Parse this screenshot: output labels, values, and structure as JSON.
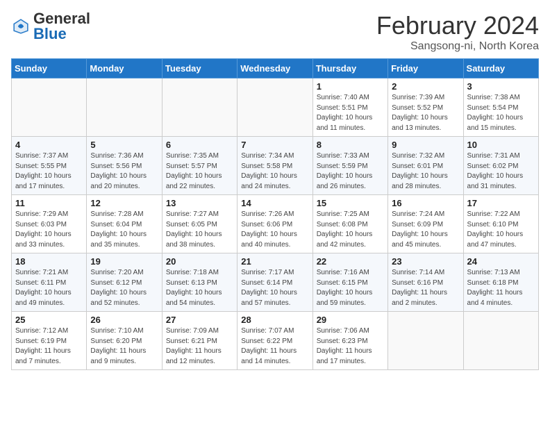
{
  "header": {
    "logo_general": "General",
    "logo_blue": "Blue",
    "month_title": "February 2024",
    "location": "Sangsong-ni, North Korea"
  },
  "days_of_week": [
    "Sunday",
    "Monday",
    "Tuesday",
    "Wednesday",
    "Thursday",
    "Friday",
    "Saturday"
  ],
  "weeks": [
    [
      {
        "day": "",
        "info": ""
      },
      {
        "day": "",
        "info": ""
      },
      {
        "day": "",
        "info": ""
      },
      {
        "day": "",
        "info": ""
      },
      {
        "day": "1",
        "info": "Sunrise: 7:40 AM\nSunset: 5:51 PM\nDaylight: 10 hours\nand 11 minutes."
      },
      {
        "day": "2",
        "info": "Sunrise: 7:39 AM\nSunset: 5:52 PM\nDaylight: 10 hours\nand 13 minutes."
      },
      {
        "day": "3",
        "info": "Sunrise: 7:38 AM\nSunset: 5:54 PM\nDaylight: 10 hours\nand 15 minutes."
      }
    ],
    [
      {
        "day": "4",
        "info": "Sunrise: 7:37 AM\nSunset: 5:55 PM\nDaylight: 10 hours\nand 17 minutes."
      },
      {
        "day": "5",
        "info": "Sunrise: 7:36 AM\nSunset: 5:56 PM\nDaylight: 10 hours\nand 20 minutes."
      },
      {
        "day": "6",
        "info": "Sunrise: 7:35 AM\nSunset: 5:57 PM\nDaylight: 10 hours\nand 22 minutes."
      },
      {
        "day": "7",
        "info": "Sunrise: 7:34 AM\nSunset: 5:58 PM\nDaylight: 10 hours\nand 24 minutes."
      },
      {
        "day": "8",
        "info": "Sunrise: 7:33 AM\nSunset: 5:59 PM\nDaylight: 10 hours\nand 26 minutes."
      },
      {
        "day": "9",
        "info": "Sunrise: 7:32 AM\nSunset: 6:01 PM\nDaylight: 10 hours\nand 28 minutes."
      },
      {
        "day": "10",
        "info": "Sunrise: 7:31 AM\nSunset: 6:02 PM\nDaylight: 10 hours\nand 31 minutes."
      }
    ],
    [
      {
        "day": "11",
        "info": "Sunrise: 7:29 AM\nSunset: 6:03 PM\nDaylight: 10 hours\nand 33 minutes."
      },
      {
        "day": "12",
        "info": "Sunrise: 7:28 AM\nSunset: 6:04 PM\nDaylight: 10 hours\nand 35 minutes."
      },
      {
        "day": "13",
        "info": "Sunrise: 7:27 AM\nSunset: 6:05 PM\nDaylight: 10 hours\nand 38 minutes."
      },
      {
        "day": "14",
        "info": "Sunrise: 7:26 AM\nSunset: 6:06 PM\nDaylight: 10 hours\nand 40 minutes."
      },
      {
        "day": "15",
        "info": "Sunrise: 7:25 AM\nSunset: 6:08 PM\nDaylight: 10 hours\nand 42 minutes."
      },
      {
        "day": "16",
        "info": "Sunrise: 7:24 AM\nSunset: 6:09 PM\nDaylight: 10 hours\nand 45 minutes."
      },
      {
        "day": "17",
        "info": "Sunrise: 7:22 AM\nSunset: 6:10 PM\nDaylight: 10 hours\nand 47 minutes."
      }
    ],
    [
      {
        "day": "18",
        "info": "Sunrise: 7:21 AM\nSunset: 6:11 PM\nDaylight: 10 hours\nand 49 minutes."
      },
      {
        "day": "19",
        "info": "Sunrise: 7:20 AM\nSunset: 6:12 PM\nDaylight: 10 hours\nand 52 minutes."
      },
      {
        "day": "20",
        "info": "Sunrise: 7:18 AM\nSunset: 6:13 PM\nDaylight: 10 hours\nand 54 minutes."
      },
      {
        "day": "21",
        "info": "Sunrise: 7:17 AM\nSunset: 6:14 PM\nDaylight: 10 hours\nand 57 minutes."
      },
      {
        "day": "22",
        "info": "Sunrise: 7:16 AM\nSunset: 6:15 PM\nDaylight: 10 hours\nand 59 minutes."
      },
      {
        "day": "23",
        "info": "Sunrise: 7:14 AM\nSunset: 6:16 PM\nDaylight: 11 hours\nand 2 minutes."
      },
      {
        "day": "24",
        "info": "Sunrise: 7:13 AM\nSunset: 6:18 PM\nDaylight: 11 hours\nand 4 minutes."
      }
    ],
    [
      {
        "day": "25",
        "info": "Sunrise: 7:12 AM\nSunset: 6:19 PM\nDaylight: 11 hours\nand 7 minutes."
      },
      {
        "day": "26",
        "info": "Sunrise: 7:10 AM\nSunset: 6:20 PM\nDaylight: 11 hours\nand 9 minutes."
      },
      {
        "day": "27",
        "info": "Sunrise: 7:09 AM\nSunset: 6:21 PM\nDaylight: 11 hours\nand 12 minutes."
      },
      {
        "day": "28",
        "info": "Sunrise: 7:07 AM\nSunset: 6:22 PM\nDaylight: 11 hours\nand 14 minutes."
      },
      {
        "day": "29",
        "info": "Sunrise: 7:06 AM\nSunset: 6:23 PM\nDaylight: 11 hours\nand 17 minutes."
      },
      {
        "day": "",
        "info": ""
      },
      {
        "day": "",
        "info": ""
      }
    ]
  ]
}
